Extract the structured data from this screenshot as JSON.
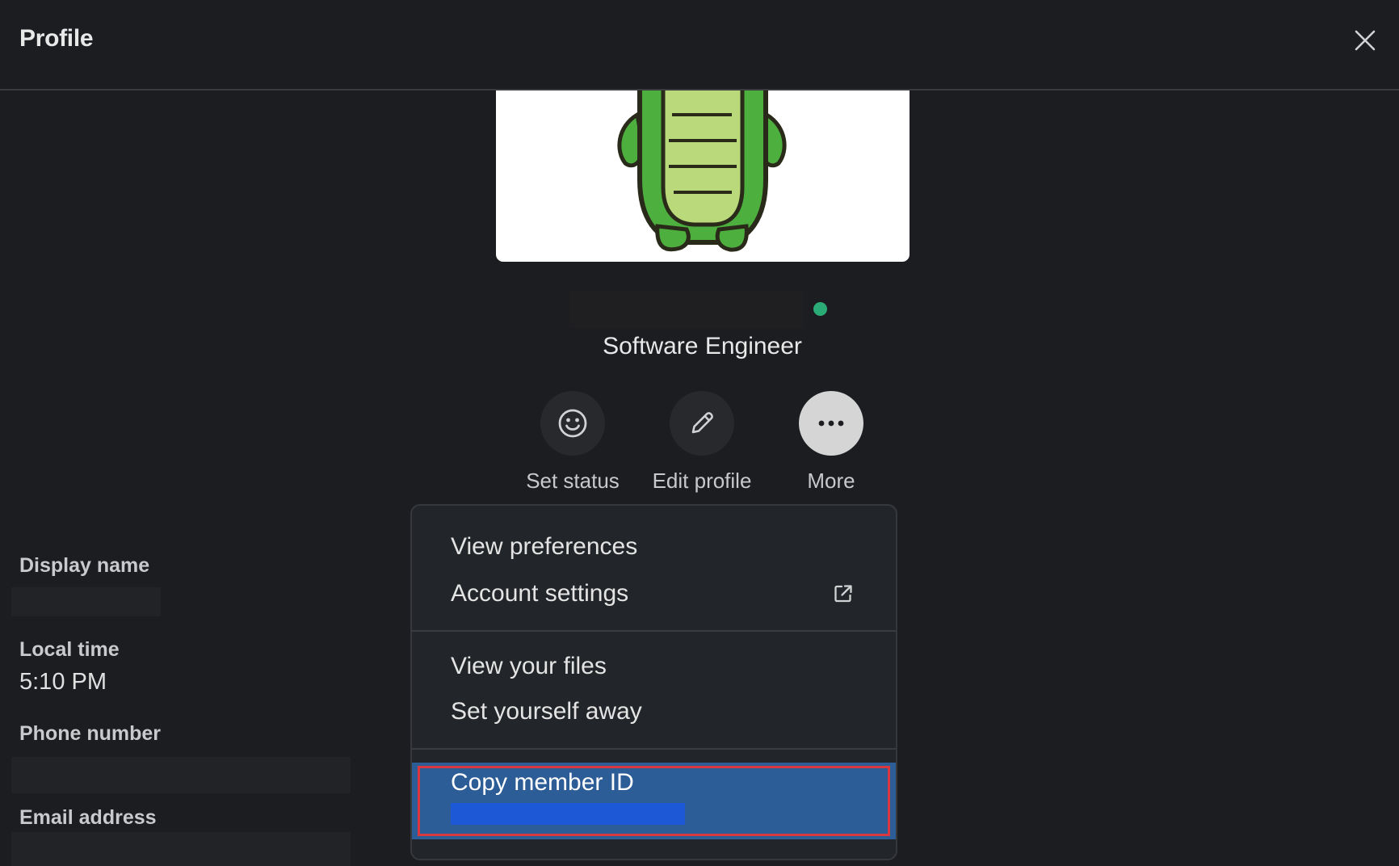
{
  "header": {
    "title": "Profile"
  },
  "profile": {
    "job_title": "Software Engineer",
    "presence_color": "#2bac76"
  },
  "actions": [
    {
      "label": "Set status",
      "icon": "smiley-icon"
    },
    {
      "label": "Edit profile",
      "icon": "pencil-icon"
    },
    {
      "label": "More",
      "icon": "ellipsis-icon"
    }
  ],
  "fields": {
    "display_name_label": "Display name",
    "local_time_label": "Local time",
    "local_time_value": "5:10 PM",
    "phone_label": "Phone number",
    "email_label": "Email address"
  },
  "menu": {
    "items": [
      {
        "label": "View preferences"
      },
      {
        "label": "Account settings",
        "icon": "external-link-icon"
      },
      {
        "label": "View your files"
      },
      {
        "label": "Set yourself away"
      },
      {
        "label": "Copy member ID",
        "highlighted": true
      }
    ],
    "highlight_color": "#2c5d97",
    "outline_color": "#d9383f"
  }
}
